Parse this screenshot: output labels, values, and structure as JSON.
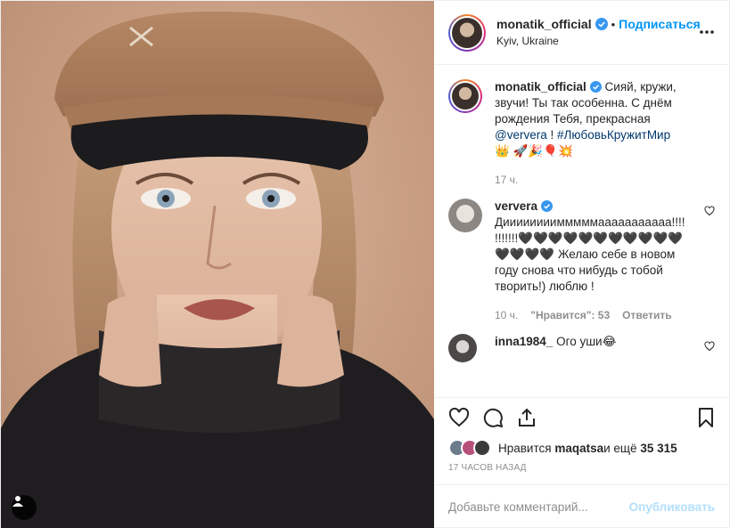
{
  "header": {
    "username": "monatik_official",
    "dot": "•",
    "follow_label": "Подписаться",
    "location": "Kyiv, Ukraine",
    "more_icon": "more-horizontal-icon"
  },
  "caption": {
    "username": "monatik_official",
    "text_part1": "Сияй, кружи, звучи! Ты так особенна. С днём рождения Тебя, прекрасная ",
    "mention": "@ververa",
    "text_part2": " ! ",
    "hashtag": "#ЛюбовьКружитМир",
    "emoji": " 👑 🚀🎉🎈💥",
    "age": "17 ч."
  },
  "comments": [
    {
      "username": "ververa",
      "text": "Диииииииимммммааааааааааа!!!!!!!!!!!🖤🖤🖤🖤🖤🖤🖤🖤🖤🖤🖤🖤🖤🖤🖤 Желаю себе в новом году снова что нибудь с тобой творить!) люблю !",
      "age": "10 ч.",
      "likes": "\"Нравится\": 53",
      "reply": "Ответить"
    },
    {
      "username": "inna1984_",
      "text": "Ого уши😂",
      "age": "",
      "likes": "",
      "reply": ""
    }
  ],
  "likes": {
    "prefix": "Нравится ",
    "user": "maqatsa",
    "middle": " и ещё ",
    "count": "35 315"
  },
  "time_label": "17 ЧАСОВ НАЗАД",
  "add_comment": {
    "placeholder": "Добавьте комментарий...",
    "publish_label": "Опубликовать"
  },
  "colors": {
    "accent": "#0095f6",
    "publish_disabled": "#b2dffc",
    "muted": "#8e8e8e"
  }
}
